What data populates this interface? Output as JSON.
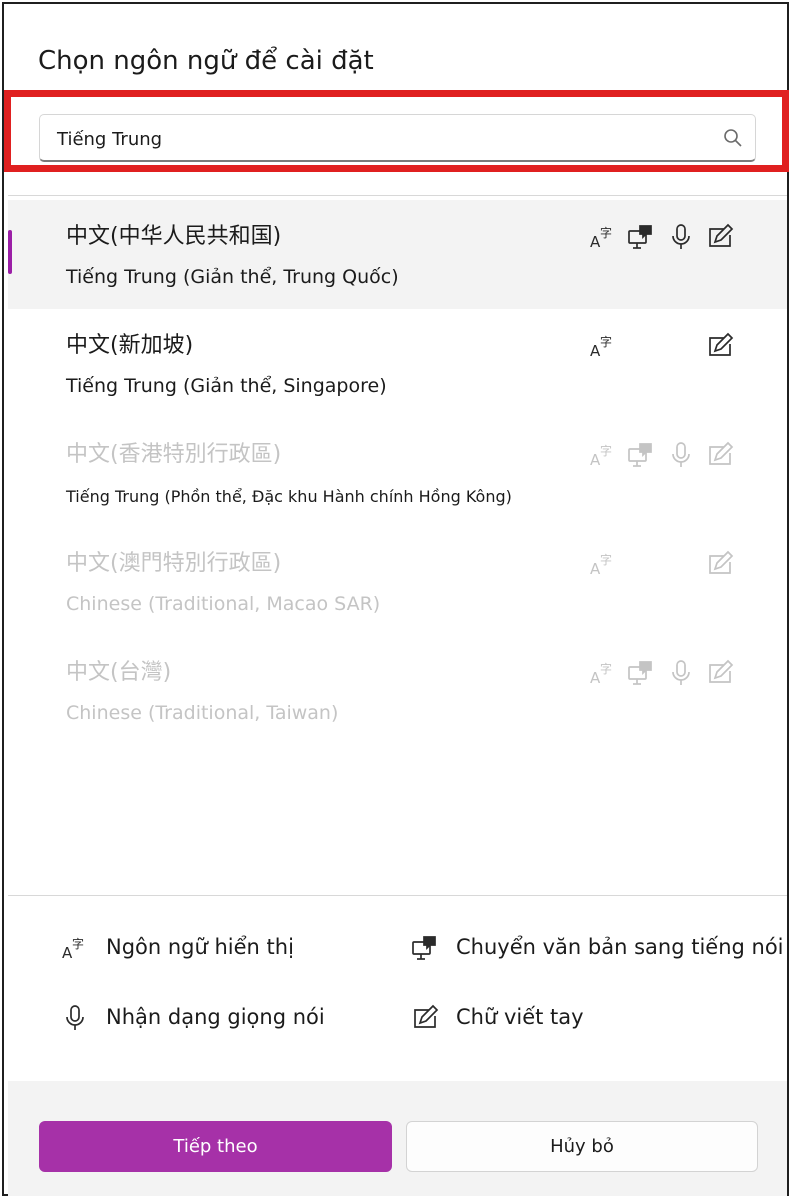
{
  "dialog": {
    "title": "Chọn ngôn ngữ để cài đặt"
  },
  "search": {
    "value": "Tiếng Trung"
  },
  "languages": [
    {
      "native": "中文(中华人民共和国)",
      "localized": "Tiếng Trung (Giản thể, Trung Quốc)",
      "enabled": true,
      "selected": true,
      "features": [
        "display-language-icon",
        "text-to-speech-icon",
        "microphone-icon",
        "handwriting-icon"
      ]
    },
    {
      "native": "中文(新加坡)",
      "localized": "Tiếng Trung (Giản thể, Singapore)",
      "enabled": true,
      "selected": false,
      "features": [
        "display-language-icon",
        "handwriting-icon"
      ]
    },
    {
      "native": "中文(香港特別行政區)",
      "localized": "Tiếng Trung (Phồn thể,      Đặc khu Hành chính Hồng Kông)",
      "enabled": false,
      "selected": false,
      "features": [
        "display-language-icon",
        "text-to-speech-icon",
        "microphone-icon",
        "handwriting-icon"
      ]
    },
    {
      "native": "中文(澳門特別行政區)",
      "localized": "Chinese (Traditional, Macao SAR)",
      "enabled": false,
      "selected": false,
      "features": [
        "display-language-icon",
        "handwriting-icon"
      ]
    },
    {
      "native": "中文(台灣)",
      "localized": "Chinese (Traditional, Taiwan)",
      "enabled": false,
      "selected": false,
      "features": [
        "display-language-icon",
        "text-to-speech-icon",
        "microphone-icon",
        "handwriting-icon"
      ]
    }
  ],
  "legend": {
    "display_language": "Ngôn ngữ hiển thị",
    "text_to_speech": "Chuyển văn bản sang tiếng nói",
    "speech_recognition": "Nhận dạng giọng nói",
    "handwriting": "Chữ viết tay"
  },
  "buttons": {
    "next": "Tiếp theo",
    "cancel": "Hủy bỏ"
  },
  "colors": {
    "accent": "#a631a8",
    "highlight_box": "#e02020",
    "disabled_text": "#c4c4c4"
  }
}
